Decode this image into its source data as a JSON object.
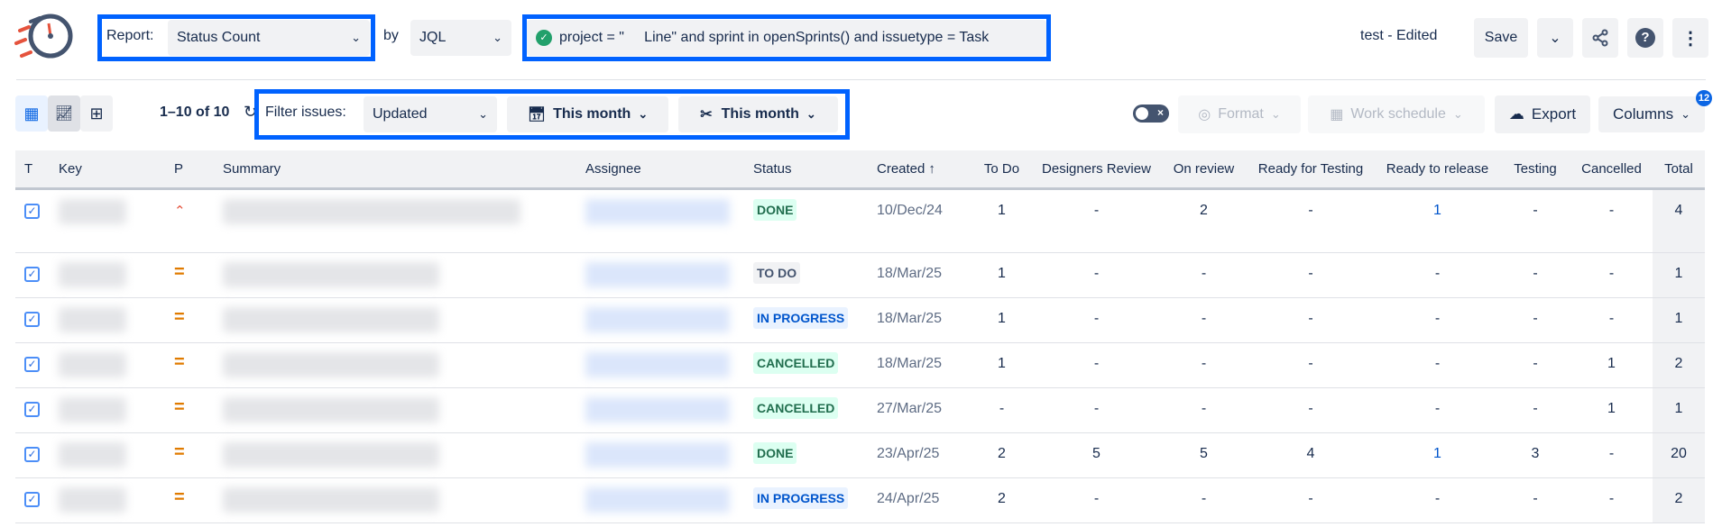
{
  "header": {
    "report_label": "Report:",
    "report_value": "Status Count",
    "by_label": "by",
    "by_value": "JQL",
    "jql": "project = \"     Line\" and sprint in openSprints() and issuetype = Task",
    "title": "test - Edited",
    "save_label": "Save"
  },
  "toolbar": {
    "pagination": "1–10 of 10",
    "filter_label": "Filter issues:",
    "filter_field": "Updated",
    "date_range_1": "This month",
    "date_range_2": "This month",
    "format_label": "Format",
    "work_schedule_label": "Work schedule",
    "export_label": "Export",
    "columns_label": "Columns",
    "columns_badge": "12"
  },
  "table": {
    "headers": [
      "T",
      "Key",
      "P",
      "Summary",
      "Assignee",
      "Status",
      "Created",
      "To Do",
      "Designers Review",
      "On review",
      "Ready for Testing",
      "Ready to release",
      "Testing",
      "Cancelled",
      "Total"
    ],
    "sort_indicator": "↑",
    "rows": [
      {
        "priority": "high",
        "status": "DONE",
        "created": "10/Dec/24",
        "counts": [
          "1",
          "-",
          "2",
          "-",
          "1",
          "-",
          "-"
        ],
        "total": "4"
      },
      {
        "priority": "medium",
        "status": "TO DO",
        "created": "18/Mar/25",
        "counts": [
          "1",
          "-",
          "-",
          "-",
          "-",
          "-",
          "-"
        ],
        "total": "1"
      },
      {
        "priority": "medium",
        "status": "IN PROGRESS",
        "created": "18/Mar/25",
        "counts": [
          "1",
          "-",
          "-",
          "-",
          "-",
          "-",
          "-"
        ],
        "total": "1"
      },
      {
        "priority": "medium",
        "status": "CANCELLED",
        "created": "18/Mar/25",
        "counts": [
          "1",
          "-",
          "-",
          "-",
          "-",
          "-",
          "1"
        ],
        "total": "2"
      },
      {
        "priority": "medium",
        "status": "CANCELLED",
        "created": "27/Mar/25",
        "counts": [
          "-",
          "-",
          "-",
          "-",
          "-",
          "-",
          "1"
        ],
        "total": "1"
      },
      {
        "priority": "medium",
        "status": "DONE",
        "created": "23/Apr/25",
        "counts": [
          "2",
          "5",
          "5",
          "4",
          "1",
          "3",
          "-"
        ],
        "total": "20"
      },
      {
        "priority": "medium",
        "status": "IN PROGRESS",
        "created": "24/Apr/25",
        "counts": [
          "2",
          "-",
          "-",
          "-",
          "-",
          "-",
          "-"
        ],
        "total": "2"
      }
    ]
  },
  "colors": {
    "accent": "#0062ff",
    "done_bg": "#dcfff1",
    "done_fg": "#216e4e",
    "todo_bg": "#f1f2f4",
    "inprog_bg": "#e9f2ff",
    "inprog_fg": "#0055cc"
  }
}
